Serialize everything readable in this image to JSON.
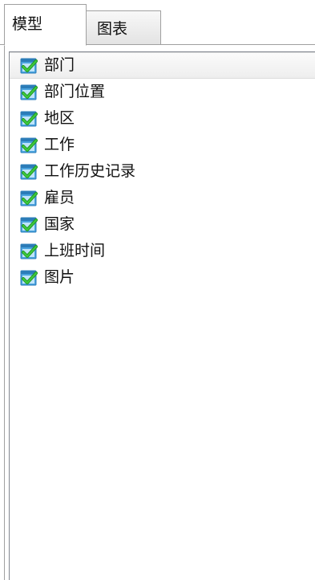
{
  "tabs": [
    {
      "label": "模型",
      "active": true
    },
    {
      "label": "图表",
      "active": false
    }
  ],
  "tree": {
    "item_icon": "table-check-icon",
    "items": [
      {
        "label": "部门",
        "selected": true
      },
      {
        "label": "部门位置",
        "selected": false
      },
      {
        "label": "地区",
        "selected": false
      },
      {
        "label": "工作",
        "selected": false
      },
      {
        "label": "工作历史记录",
        "selected": false
      },
      {
        "label": "雇员",
        "selected": false
      },
      {
        "label": "国家",
        "selected": false
      },
      {
        "label": "上班时间",
        "selected": false
      },
      {
        "label": "图片",
        "selected": false
      }
    ]
  },
  "colors": {
    "icon_fill": "#4aa3df",
    "icon_check": "#3cc83c",
    "border": "#a0a0a0"
  }
}
